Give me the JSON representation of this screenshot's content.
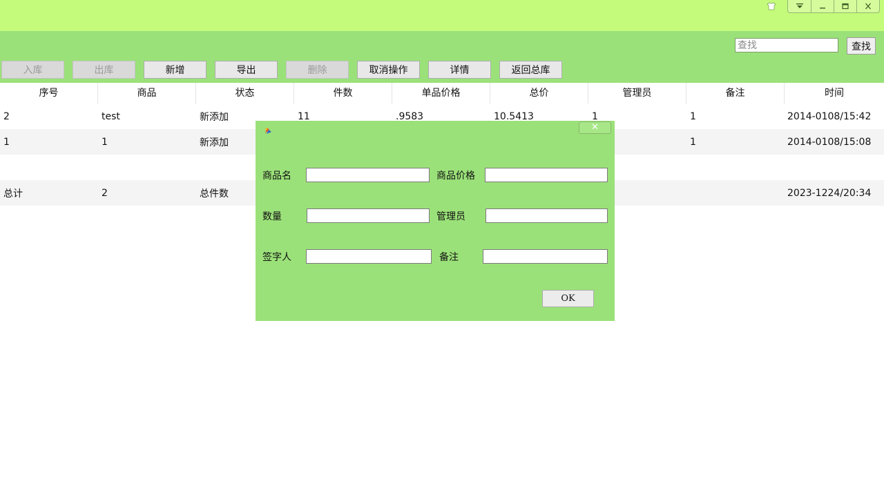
{
  "window": {
    "controls": [
      "dropdown-icon",
      "minimize-icon",
      "maximize-icon",
      "close-icon"
    ]
  },
  "toolbar": {
    "search_placeholder": "查找",
    "search_button": "查找",
    "buttons": [
      {
        "label": "入库",
        "disabled": true
      },
      {
        "label": "出库",
        "disabled": true
      },
      {
        "label": "新增",
        "disabled": false
      },
      {
        "label": "导出",
        "disabled": false
      },
      {
        "label": "删除",
        "disabled": true
      },
      {
        "label": "取消操作",
        "disabled": false
      },
      {
        "label": "详情",
        "disabled": false
      },
      {
        "label": "返回总库",
        "disabled": false
      }
    ]
  },
  "table": {
    "columns": [
      "序号",
      "商品",
      "状态",
      "件数",
      "单品价格",
      "总价",
      "管理员",
      "备注",
      "时间"
    ],
    "rows": [
      [
        "2",
        "test",
        "新添加",
        "11",
        ".9583",
        "10.5413",
        "1",
        "1",
        "2014-0108/15:42"
      ],
      [
        "1",
        "1",
        "新添加",
        "",
        "",
        "",
        "",
        "1",
        "2014-0108/15:08"
      ],
      [
        "",
        "",
        "",
        "",
        "",
        "",
        "",
        "",
        ""
      ],
      [
        "总计",
        "2",
        "总件数",
        "",
        "",
        "",
        "",
        "",
        "2023-1224/20:34"
      ]
    ]
  },
  "dialog": {
    "close_symbol": "✕",
    "fields": {
      "product_name": "商品名",
      "product_price": "商品价格",
      "quantity": "数量",
      "manager": "管理员",
      "signer": "签字人",
      "remark": "备注"
    },
    "ok_label": "OK"
  }
}
